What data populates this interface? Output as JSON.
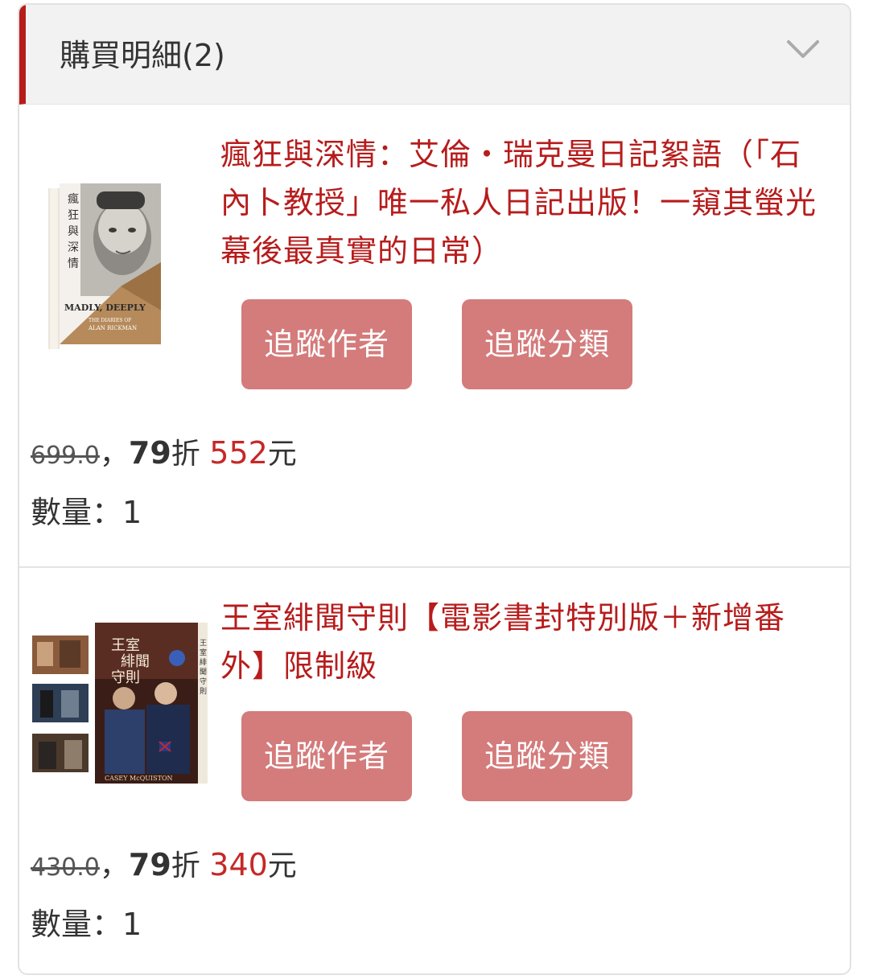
{
  "header": {
    "title": "購買明細(2)"
  },
  "items": [
    {
      "title": "瘋狂與深情：艾倫・瑞克曼日記絮語（「石內卜教授」唯一私人日記出版！一窺其螢光幕後最真實的日常）",
      "follow_author": "追蹤作者",
      "follow_category": "追蹤分類",
      "original_price": "699.0",
      "sep": "，",
      "discount": "79",
      "discount_unit": "折",
      "final_price": "552",
      "currency": "元",
      "qty_label": "數量：",
      "qty": "1",
      "cover_text": {
        "title_vertical": "瘋狂與深情",
        "title_en": "MADLY, DEEPLY",
        "sub_en": "THE DIARIES OF",
        "author_en": "ALAN RICKMAN"
      }
    },
    {
      "title": "王室緋聞守則【電影書封特別版＋新增番外】限制級",
      "follow_author": "追蹤作者",
      "follow_category": "追蹤分類",
      "original_price": "430.0",
      "sep": "，",
      "discount": "79",
      "discount_unit": "折",
      "final_price": "340",
      "currency": "元",
      "qty_label": "數量：",
      "qty": "1",
      "cover_text": {
        "title_cn": "王室緋聞守則",
        "author_en": "CASEY McQUISTON"
      }
    }
  ],
  "colors": {
    "accent": "#b71c1c",
    "button": "#d47b7b",
    "price": "#c62828"
  }
}
